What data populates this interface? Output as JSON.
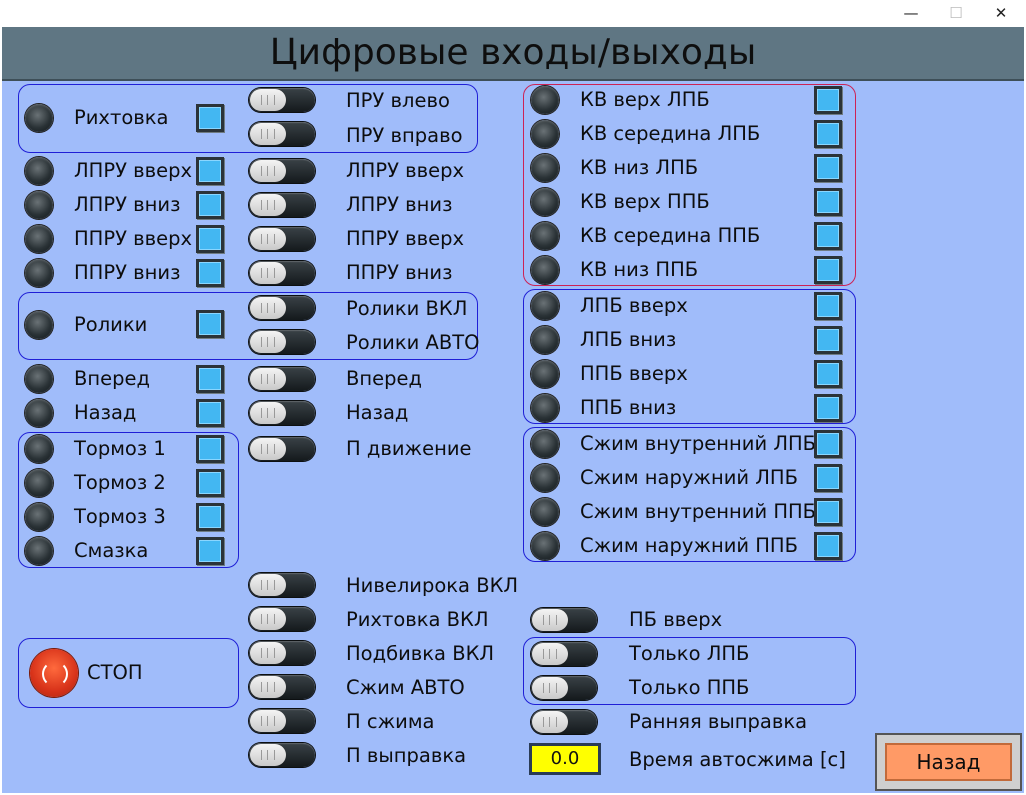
{
  "window": {
    "controls": {
      "minimize": "—",
      "maximize": "☐",
      "close": "✕"
    }
  },
  "header": {
    "title": "Цифровые входы/выходы"
  },
  "inputs": {
    "rihtovka": "Рихтовка",
    "lpru_up": "ЛПРУ вверх",
    "lpru_down": "ЛПРУ вниз",
    "ppru_up": "ППРУ вверх",
    "ppru_down": "ППРУ вниз",
    "roliki": "Ролики",
    "forward": "Вперед",
    "back": "Назад",
    "brake1": "Тормоз 1",
    "brake2": "Тормоз 2",
    "brake3": "Тормоз 3",
    "grease": "Смазка"
  },
  "outputs": {
    "pru_left": "ПРУ влево",
    "pru_right": "ПРУ вправо",
    "lpru_up": "ЛПРУ вверх",
    "lpru_down": "ЛПРУ вниз",
    "ppru_up": "ППРУ вверх",
    "ppru_down": "ППРУ вниз",
    "roliki_on": "Ролики ВКЛ",
    "roliki_auto": "Ролики АВТО",
    "forward": "Вперед",
    "back": "Назад",
    "p_move": "П движение",
    "level_on": "Нивелирока ВКЛ",
    "rihtovka_on": "Рихтовка ВКЛ",
    "podbivka_on": "Подбивка ВКЛ",
    "clamp_auto": "Сжим АВТО",
    "p_clamp": "П сжима",
    "p_straighten": "П выправка"
  },
  "limit_switches": {
    "kv_top_lpb": "КВ верх ЛПБ",
    "kv_mid_lpb": "КВ середина ЛПБ",
    "kv_bottom_lpb": "КВ низ ЛПБ",
    "kv_top_ppb": "КВ верх ППБ",
    "kv_mid_ppb": "КВ середина ППБ",
    "kv_bottom_ppb": "КВ низ ППБ"
  },
  "pb_moves": {
    "lpb_up": "ЛПБ вверх",
    "lpb_down": "ЛПБ вниз",
    "ppb_up": "ППБ вверх",
    "ppb_down": "ППБ вниз"
  },
  "clamps": {
    "inner_lpb": "Сжим внутренний ЛПБ",
    "outer_lpb": "Сжим наружний ЛПБ",
    "inner_ppb": "Сжим внутренний ППБ",
    "outer_ppb": "Сжим наружний ППБ"
  },
  "modes": {
    "pb_up": "ПБ вверх",
    "only_lpb": "Только ЛПБ",
    "only_ppb": "Только ППБ",
    "early_straighten": "Ранняя выправка"
  },
  "autoclamp": {
    "value": "0.0",
    "label": "Время автосжима [с]"
  },
  "stop": {
    "label": "СТОП"
  },
  "nav": {
    "back_label": "Назад"
  },
  "colors": {
    "panel_bg": "#a0bcfa",
    "header_bg": "#5f7683",
    "indicator_blue": "#43b7f2",
    "group_border_blue": "#1f1fd6",
    "group_border_red": "#cc2255",
    "stop_red": "#d8331a",
    "value_field_yellow": "#ffff00",
    "back_button": "#ff9a66"
  }
}
